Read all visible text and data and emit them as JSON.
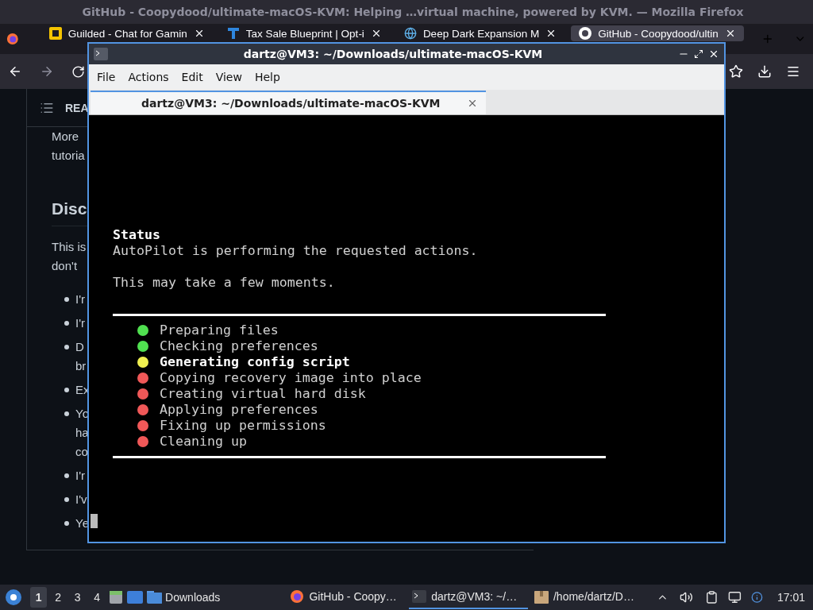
{
  "browser": {
    "title": "GitHub - Coopydood/ultimate-macOS-KVM: Helping …virtual machine, powered by KVM. — Mozilla Firefox",
    "tabs": [
      {
        "label": "Guilded - Chat for Gamin",
        "selected": false
      },
      {
        "label": "Tax Sale Blueprint | Opt-i",
        "selected": false
      },
      {
        "label": "Deep Dark Expansion M",
        "selected": false
      },
      {
        "label": "GitHub - Coopydood/ultin",
        "selected": true
      }
    ]
  },
  "page": {
    "section_tab": "REA",
    "blocks": [
      {
        "kind": "paragraph",
        "lines": [
          "More",
          "tutoria"
        ]
      },
      {
        "kind": "heading",
        "lines": [
          "Disc"
        ]
      },
      {
        "kind": "paragraph",
        "lines": [
          "This is",
          "don't"
        ]
      },
      {
        "kind": "bullet",
        "lines": [
          "I'r"
        ]
      },
      {
        "kind": "bullet",
        "lines": [
          "I'r"
        ]
      },
      {
        "kind": "bullet",
        "lines": [
          "D",
          "br"
        ]
      },
      {
        "kind": "bullet",
        "lines": [
          "Ex"
        ]
      },
      {
        "kind": "bullet",
        "lines": [
          "Yo",
          "ha",
          "co"
        ]
      },
      {
        "kind": "bullet",
        "lines": [
          "I'r"
        ]
      },
      {
        "kind": "bullet",
        "lines": [
          "I'v"
        ]
      },
      {
        "kind": "bullet",
        "lines": [
          "Ye"
        ]
      }
    ]
  },
  "terminal": {
    "title": "dartz@VM3: ~/Downloads/ultimate-macOS-KVM",
    "menu": [
      "File",
      "Actions",
      "Edit",
      "View",
      "Help"
    ],
    "tab": {
      "label": "dartz@VM3: ~/Downloads/ultimate-macOS-KVM",
      "selected": true
    },
    "heading": "Status",
    "paragraphs": [
      "AutoPilot is performing the requested actions.",
      "This may take a few moments."
    ],
    "steps": [
      {
        "label": "Preparing files",
        "color": "#50e050",
        "active": false
      },
      {
        "label": "Checking preferences",
        "color": "#50e050",
        "active": false
      },
      {
        "label": "Generating config script",
        "color": "#f0f050",
        "active": true
      },
      {
        "label": "Copying recovery image into place",
        "color": "#f05858",
        "active": false
      },
      {
        "label": "Creating virtual hard disk",
        "color": "#f05858",
        "active": false
      },
      {
        "label": "Applying preferences",
        "color": "#f05858",
        "active": false
      },
      {
        "label": "Fixing up permissions",
        "color": "#f05858",
        "active": false
      },
      {
        "label": "Cleaning up",
        "color": "#f05858",
        "active": false
      }
    ]
  },
  "taskbar": {
    "workspaces": [
      {
        "label": "1",
        "selected": true
      },
      {
        "label": "2",
        "selected": false
      },
      {
        "label": "3",
        "selected": false
      },
      {
        "label": "4",
        "selected": false
      }
    ],
    "folder": "Downloads",
    "tasks": [
      {
        "label": "GitHub - Coopy…",
        "selected": false
      },
      {
        "label": "dartz@VM3: ~/…",
        "selected": true
      },
      {
        "label": "/home/dartz/D…",
        "selected": false
      }
    ],
    "clock": "17:01"
  }
}
